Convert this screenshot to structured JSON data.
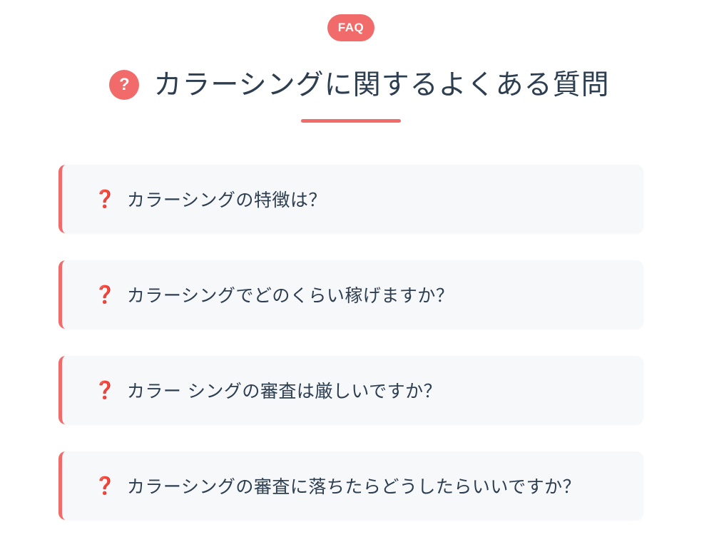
{
  "header": {
    "badge": "FAQ",
    "title_icon": "?",
    "title": "カラーシングに関するよくある質問"
  },
  "faq": {
    "icon": "❓",
    "items": [
      {
        "question": "カラーシングの特徴は？"
      },
      {
        "question": "カラーシングでどのくらい稼げますか？"
      },
      {
        "question": "カラー シングの審査は厳しいですか？"
      },
      {
        "question": "カラーシングの審査に落ちたらどうしたらいいですか？"
      }
    ]
  },
  "colors": {
    "accent": "#f26b6b",
    "question_mark": "#d0021b",
    "text": "#2c3e50",
    "card_bg": "#f7f8fa"
  }
}
